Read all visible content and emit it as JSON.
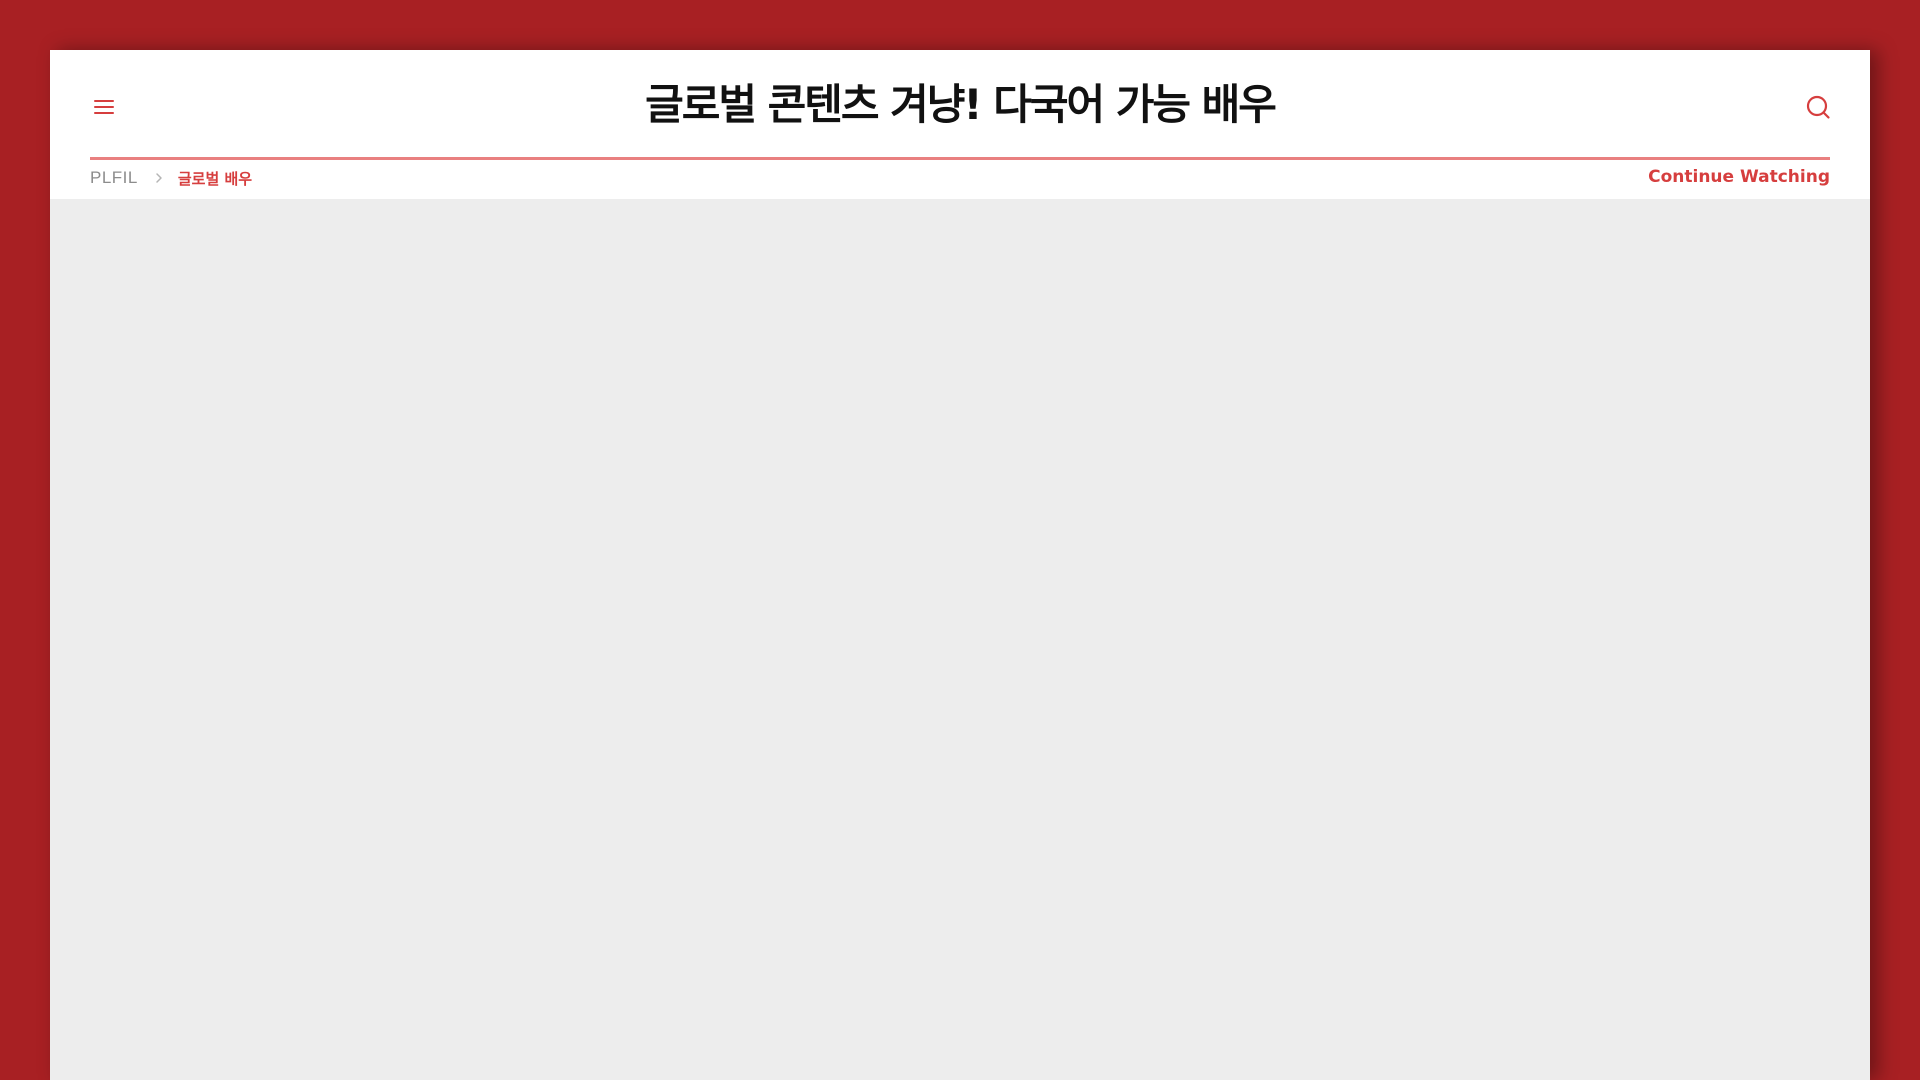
{
  "header": {
    "title": "글로벌 콘텐츠 겨냥! 다국어 가능 배우",
    "menu_icon": "hamburger-menu-icon",
    "search_icon": "search-icon"
  },
  "breadcrumb": {
    "home": "PLFIL",
    "separator_icon": "chevron-right-icon",
    "current": "글로벌 배우"
  },
  "actions": {
    "continue_watching": "Continue Watching"
  },
  "colors": {
    "background": "#a82023",
    "accent": "#d63e3e",
    "divider": "#e98080",
    "content_bg": "#ededed"
  }
}
